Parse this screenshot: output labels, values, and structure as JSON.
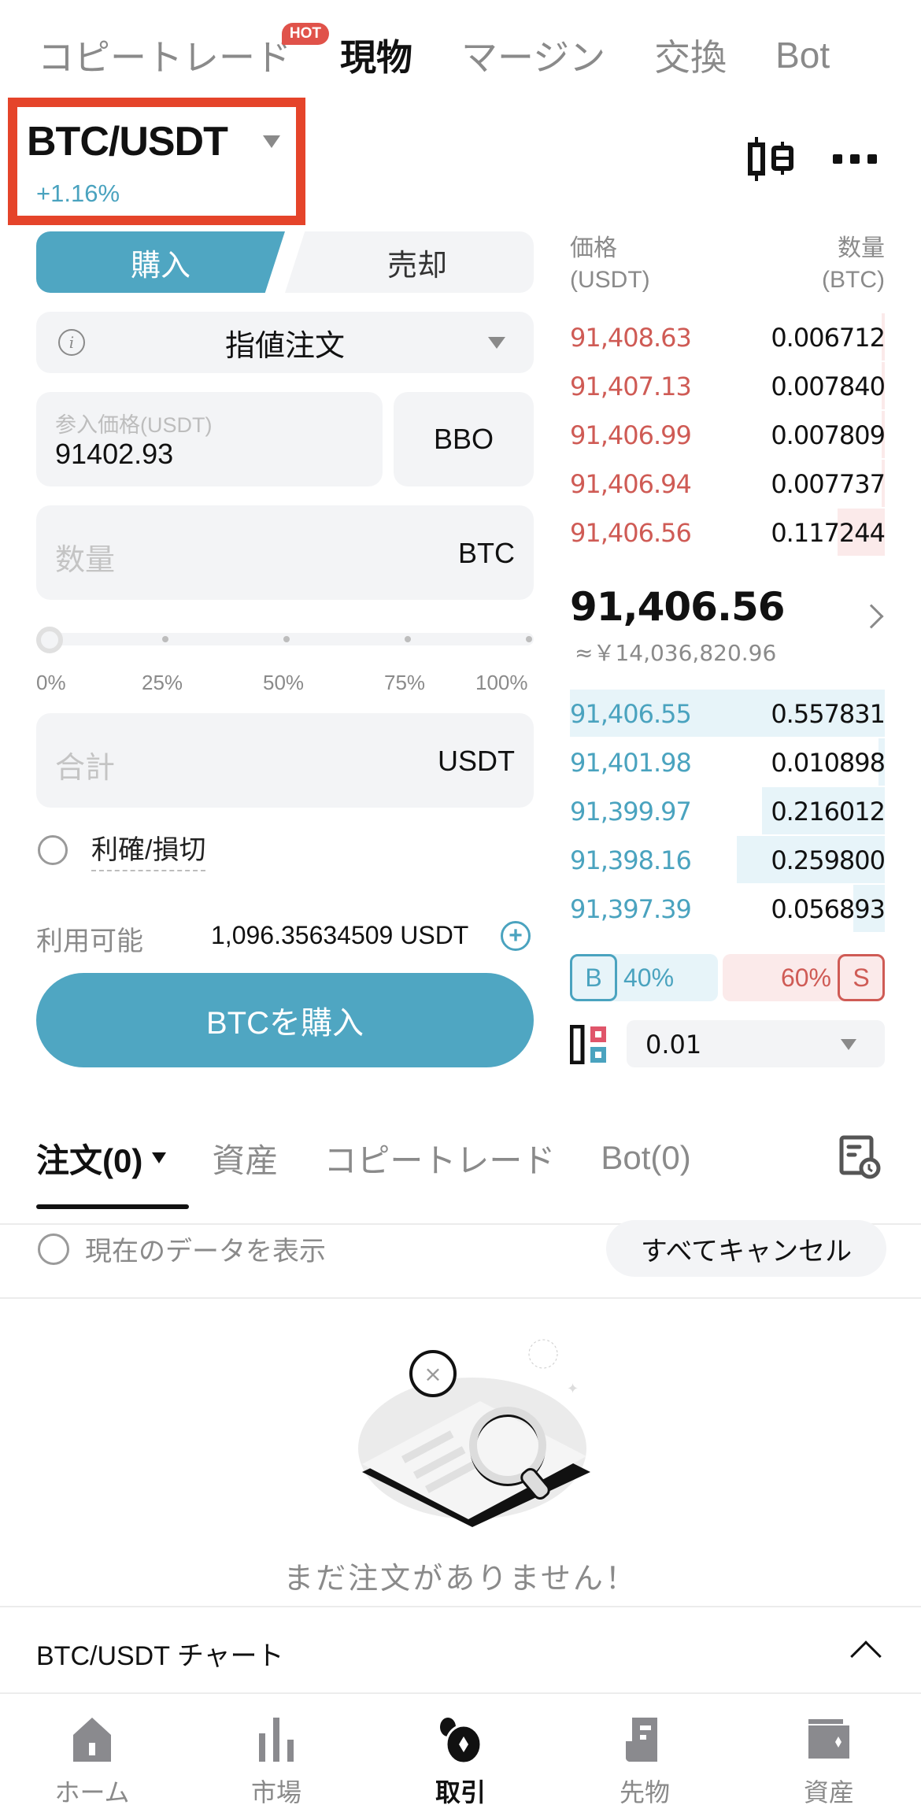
{
  "top_tabs": [
    {
      "label": "コピートレード",
      "badge": "HOT",
      "active": false
    },
    {
      "label": "現物",
      "active": true
    },
    {
      "label": "マージン",
      "active": false
    },
    {
      "label": "交換",
      "active": false
    },
    {
      "label": "Bot",
      "active": false
    }
  ],
  "pair": {
    "name": "BTC/USDT",
    "change": "+1.16%"
  },
  "order_form": {
    "buy_label": "購入",
    "sell_label": "売却",
    "order_type": "指値注文",
    "price_label": "参入価格(USDT)",
    "price_value": "91402.93",
    "bbo_label": "BBO",
    "quantity_placeholder": "数量",
    "quantity_unit": "BTC",
    "slider_value_percent": 0,
    "slider_labels": [
      "0%",
      "25%",
      "50%",
      "75%",
      "100%"
    ],
    "total_placeholder": "合計",
    "total_unit": "USDT",
    "tpsl_label": "利確/損切",
    "available_label": "利用可能",
    "available_value": "1,096.35634509 USDT",
    "submit_label": "BTCを購入"
  },
  "order_book": {
    "price_header": "価格",
    "price_unit": "(USDT)",
    "qty_header": "数量",
    "qty_unit": "(BTC)",
    "asks": [
      {
        "price": "91,408.63",
        "qty": "0.006712",
        "depth": 0.01
      },
      {
        "price": "91,407.13",
        "qty": "0.007840",
        "depth": 0.01
      },
      {
        "price": "91,406.99",
        "qty": "0.007809",
        "depth": 0.01
      },
      {
        "price": "91,406.94",
        "qty": "0.007737",
        "depth": 0.01
      },
      {
        "price": "91,406.56",
        "qty": "0.117244",
        "depth": 0.15
      }
    ],
    "last_price": "91,406.56",
    "last_price_fiat": "≈￥14,036,820.96",
    "bids": [
      {
        "price": "91,406.55",
        "qty": "0.557831",
        "depth": 1.0
      },
      {
        "price": "91,401.98",
        "qty": "0.010898",
        "depth": 0.02
      },
      {
        "price": "91,399.97",
        "qty": "0.216012",
        "depth": 0.39
      },
      {
        "price": "91,398.16",
        "qty": "0.259800",
        "depth": 0.47
      },
      {
        "price": "91,397.39",
        "qty": "0.056893",
        "depth": 0.1
      }
    ],
    "buy_ratio_label": "B",
    "buy_ratio": "40%",
    "sell_ratio_label": "S",
    "sell_ratio": "60%",
    "precision": "0.01"
  },
  "orders": {
    "tabs": [
      {
        "label": "注文(0)",
        "active": true
      },
      {
        "label": "資産",
        "active": false
      },
      {
        "label": "コピートレード",
        "active": false
      },
      {
        "label": "Bot(0)",
        "active": false
      }
    ],
    "show_current_label": "現在のデータを表示",
    "cancel_all_label": "すべてキャンセル",
    "empty_text": "まだ注文がありません！"
  },
  "chart_bar": {
    "label": "BTC/USDT  チャート"
  },
  "bottom_nav": [
    {
      "label": "ホーム",
      "icon": "home-icon",
      "active": false
    },
    {
      "label": "市場",
      "icon": "market-icon",
      "active": false
    },
    {
      "label": "取引",
      "icon": "trade-icon",
      "active": true
    },
    {
      "label": "先物",
      "icon": "futures-icon",
      "active": false
    },
    {
      "label": "資産",
      "icon": "wallet-icon",
      "active": false
    }
  ],
  "colors": {
    "accent": "#4fa6c2",
    "buy": "#4aa3bf",
    "sell": "#cf5b55",
    "highlight_box": "#e5442a"
  }
}
